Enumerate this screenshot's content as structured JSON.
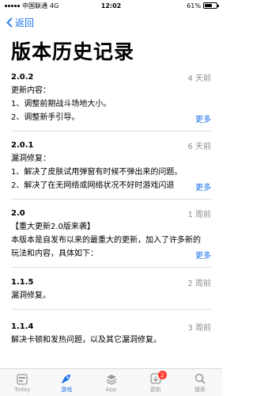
{
  "status_bar": {
    "carrier": "中国联通",
    "network": "4G",
    "time": "12:02",
    "battery": "61%",
    "battery_level": 0.61
  },
  "nav": {
    "back_label": "返回"
  },
  "page_title": "版本历史记录",
  "more_label": "更多",
  "versions": [
    {
      "version": "2.0.2",
      "date": "4 天前",
      "lines": [
        "更新内容：",
        "1、调整前期战斗场地大小。",
        "2、调整新手引导。"
      ],
      "has_more": true
    },
    {
      "version": "2.0.1",
      "date": "6 天前",
      "lines": [
        "漏洞修复：",
        "1、解决了皮肤试用弹窗有时候不弹出来的问题。",
        "2、解决了在无网络或网络状况不好时游戏闪退"
      ],
      "has_more": true
    },
    {
      "version": "2.0",
      "date": "1 周前",
      "lines": [
        "【重大更新2.0版来袭】",
        "本版本是自发布以来的最重大的更新，加入了许多新的",
        "玩法和内容，具体如下："
      ],
      "has_more": true
    },
    {
      "version": "1.1.5",
      "date": "2 周前",
      "lines": [
        "漏洞修复。"
      ],
      "has_more": false
    },
    {
      "version": "1.1.4",
      "date": "3 周前",
      "lines": [
        "解决卡顿和发热问题，以及其它漏洞修复。"
      ],
      "has_more": false
    }
  ],
  "tabbar": {
    "items": [
      {
        "label": "Today",
        "icon": "today-icon"
      },
      {
        "label": "游戏",
        "icon": "games-rocket-icon"
      },
      {
        "label": "App",
        "icon": "apps-stack-icon"
      },
      {
        "label": "更新",
        "icon": "updates-download-icon",
        "badge": "2"
      },
      {
        "label": "搜索",
        "icon": "search-icon"
      }
    ],
    "active_index": 1
  }
}
